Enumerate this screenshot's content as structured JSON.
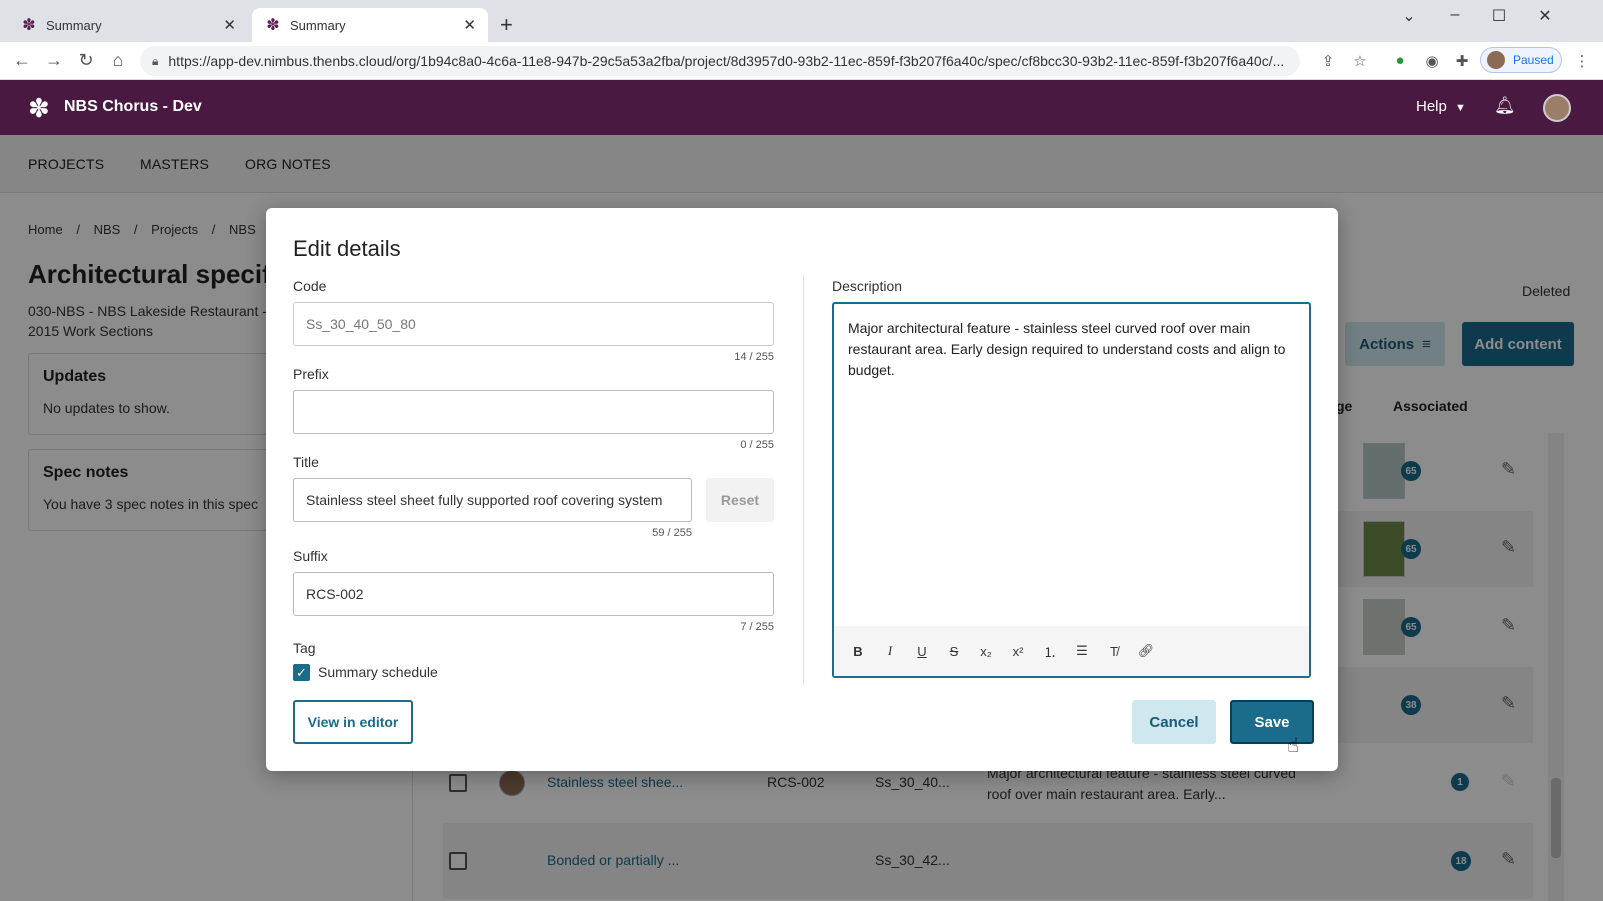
{
  "browser": {
    "tabs": [
      {
        "label": "Summary"
      },
      {
        "label": "Summary"
      }
    ],
    "url": "https://app-dev.nimbus.thenbs.cloud/org/1b94c8a0-4c6a-11e8-947b-29c5a53a2fba/project/8d3957d0-93b2-11ec-859f-f3b207f6a40c/spec/cf8bcc30-93b2-11ec-859f-f3b207f6a40c/...",
    "profile_label": "Paused"
  },
  "app": {
    "brand": "NBS Chorus - Dev",
    "help_label": "Help",
    "nav": [
      "PROJECTS",
      "MASTERS",
      "ORG NOTES"
    ]
  },
  "page": {
    "breadcrumbs": [
      "Home",
      "/",
      "NBS",
      "/",
      "Projects",
      "/",
      "NBS"
    ],
    "title": "Architectural specif",
    "subtitle_line1": "030-NBS - NBS Lakeside Restaurant -",
    "subtitle_line2": "2015 Work Sections",
    "updates_title": "Updates",
    "updates_text": "No updates to show.",
    "specnotes_title": "Spec notes",
    "specnotes_text": "You have 3 spec notes in this spec",
    "deleted_label": "Deleted",
    "actions_label": "Actions",
    "add_content_label": "Add content",
    "col_image_partial": "ge",
    "col_associated": "Associated",
    "rows": [
      {
        "badge": "65"
      },
      {
        "badge": "65"
      },
      {
        "badge": "65"
      },
      {
        "badge": "38"
      },
      {
        "title": "Stainless steel shee...",
        "suffix": "RCS-002",
        "code": "Ss_30_40...",
        "description": "Major architectural feature - stainless steel curved roof over main restaurant area. Early...",
        "badge": "1"
      },
      {
        "title": "Bonded or partially ...",
        "code": "Ss_30_42...",
        "badge": "18"
      }
    ]
  },
  "modal": {
    "title": "Edit details",
    "code_label": "Code",
    "code_value": "Ss_30_40_50_80",
    "code_counter": "14 / 255",
    "prefix_label": "Prefix",
    "prefix_value": "",
    "prefix_counter": "0 / 255",
    "title_label": "Title",
    "title_value": "Stainless steel sheet fully supported roof covering system",
    "title_counter": "59 / 255",
    "reset_label": "Reset",
    "suffix_label": "Suffix",
    "suffix_value": "RCS-002",
    "suffix_counter": "7 / 255",
    "tag_label": "Tag",
    "tag_option": "Summary schedule",
    "tag_checked": true,
    "view_in_editor_label": "View in editor",
    "description_label": "Description",
    "description_value": "Major architectural feature - stainless steel curved roof over main restaurant area. Early design required to understand costs and align to budget.",
    "toolbar": [
      "B",
      "I",
      "U",
      "S",
      "x₂",
      "x²",
      "ordered-list",
      "bullet-list",
      "clear-format",
      "link"
    ],
    "cancel_label": "Cancel",
    "save_label": "Save"
  },
  "colors": {
    "brand_purple": "#4a1942",
    "primary_teal": "#1b6b8c",
    "secondary_button_bg": "#cfe7ef"
  }
}
